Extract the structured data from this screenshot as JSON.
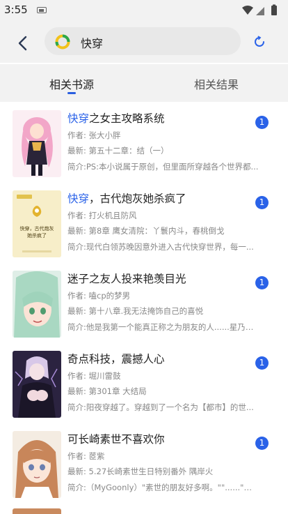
{
  "status_bar": {
    "time": "3:55"
  },
  "search": {
    "query": "快穿"
  },
  "tabs": [
    {
      "label": "相关书源",
      "active": true
    },
    {
      "label": "相关结果",
      "active": false
    }
  ],
  "colors": {
    "accent": "#2a62e8",
    "background": "#f2f2f2",
    "search_field": "#e8e8e8"
  },
  "books": [
    {
      "title_highlight": "快穿",
      "title_rest": "之女主攻略系统",
      "author": "作者: 张大小胖",
      "latest": "最新: 第五十二章：结（一）",
      "intro": "简介:PS:本小说属于原创，但里面所穿越各个世界都...",
      "count": "1"
    },
    {
      "title_highlight": "快穿",
      "title_rest": "，古代炮灰她杀疯了",
      "author": "作者: 打火机且防风",
      "latest": "最新: 第8章 鹰女清院：丫鬟内斗，春桃倒戈",
      "intro": "简介:现代白领苏晚因意外进入古代快穿世界，每一...",
      "count": "1",
      "cover_text": "快穿，古代炮灰她杀疯了"
    },
    {
      "title_highlight": "",
      "title_rest": "迷子之友人投来艳羡目光",
      "author": "作者: 嗑cp的梦男",
      "latest": "最新: 第十八章.我无法掩饰自己的喜悦",
      "intro": "简介:他是我第一个能真正称之为朋友的人......星乃结...",
      "count": "1"
    },
    {
      "title_highlight": "",
      "title_rest": "奇点科技，震撼人心",
      "author": "作者: 堀川雷鼓",
      "latest": "最新: 第301章 大结局",
      "intro": "简介:阳夜穿越了。穿越到了一个名为【都市】的世...",
      "count": "1"
    },
    {
      "title_highlight": "",
      "title_rest": "可长崎素世不喜欢你",
      "author": "作者: 茝紫",
      "latest": "最新: 5.27长崎素世生日特别番外 隅岸火",
      "intro": "简介:（MyGoonly）\"素世的朋友好多啊。\"\"......\"似乎...",
      "count": "1"
    }
  ]
}
